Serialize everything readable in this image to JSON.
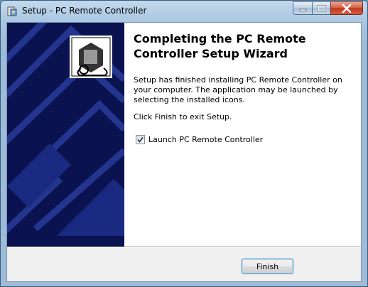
{
  "window": {
    "title": "Setup - PC Remote Controller",
    "controls": {
      "minimize": "minimize",
      "maximize": "maximize",
      "close": "close"
    }
  },
  "wizard": {
    "heading": "Completing the PC Remote Controller Setup Wizard",
    "message": "Setup has finished installing PC Remote Controller on your computer. The application may be launched by selecting the installed icons.",
    "instruction": "Click Finish to exit Setup.",
    "launch_checkbox": {
      "label": "Launch PC Remote Controller",
      "checked": true
    }
  },
  "buttons": {
    "finish": "Finish"
  },
  "colors": {
    "side_panel": "#0a1250",
    "titlebar": "#a9c6e1",
    "close_button": "#c2371d"
  }
}
